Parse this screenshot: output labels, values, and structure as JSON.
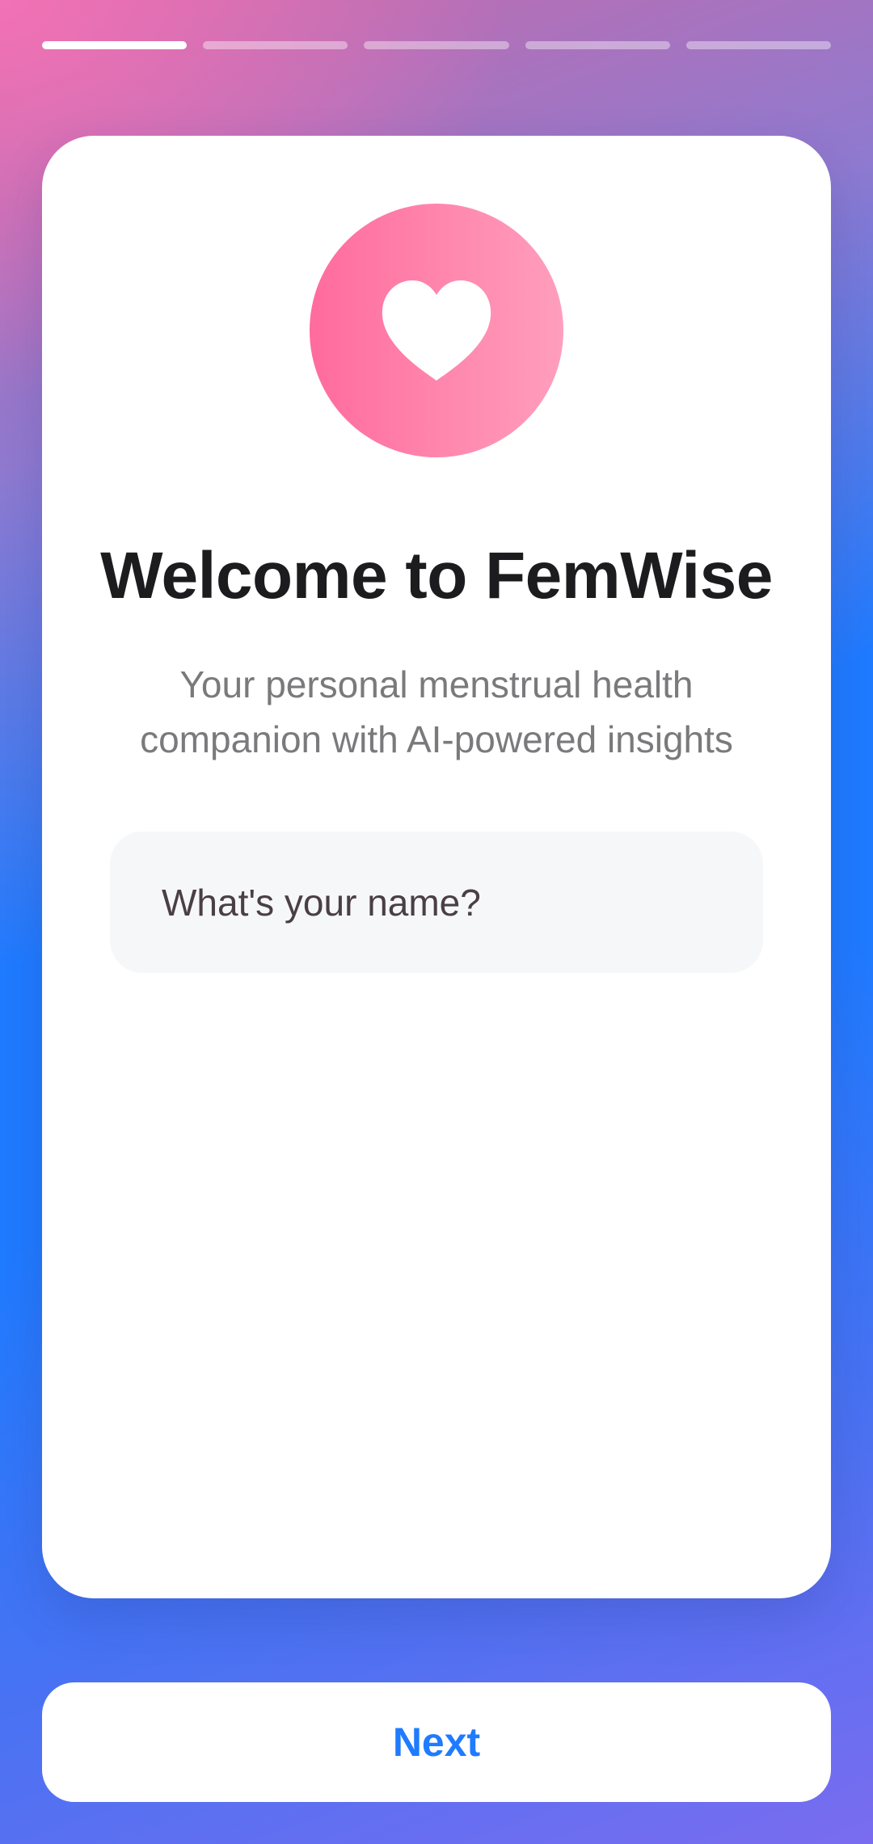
{
  "onboarding": {
    "total_steps": 5,
    "current_step": 1
  },
  "card": {
    "logo_icon": "heart-icon",
    "title": "Welcome to FemWise",
    "subtitle": "Your personal menstrual health companion with AI-powered insights"
  },
  "name_input": {
    "placeholder": "What's your name?",
    "value": ""
  },
  "footer": {
    "next_label": "Next"
  },
  "colors": {
    "accent": "#1f7bff",
    "logo_pink": "#ff6b9d",
    "title": "#1c1c1e",
    "subtitle": "#7a7a7c"
  }
}
